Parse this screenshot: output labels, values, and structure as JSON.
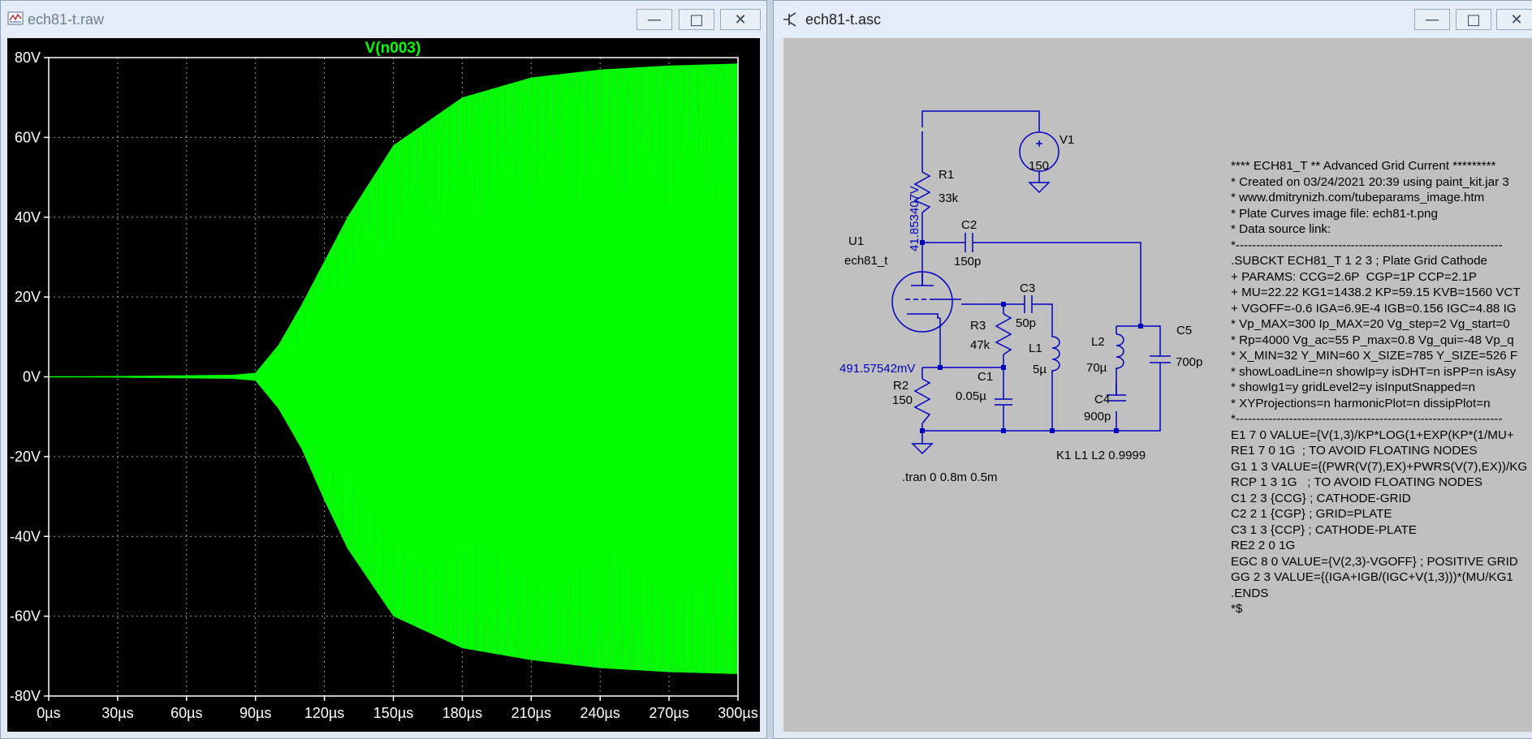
{
  "waveform_window": {
    "title": "ech81-t.raw",
    "trace_label": "V(n003)",
    "trace_color": "#00ff00",
    "y_ticks": [
      "80V",
      "60V",
      "40V",
      "20V",
      "0V",
      "-20V",
      "-40V",
      "-60V",
      "-80V"
    ],
    "x_ticks": [
      "0µs",
      "30µs",
      "60µs",
      "90µs",
      "120µs",
      "150µs",
      "180µs",
      "210µs",
      "240µs",
      "270µs",
      "300µs"
    ],
    "buttons": {
      "minimize": "—",
      "restore": "□",
      "close": "✕"
    }
  },
  "chart_data": {
    "type": "area",
    "title": "V(n003)",
    "xlabel": "",
    "ylabel": "",
    "x_unit": "µs",
    "y_unit": "V",
    "xlim": [
      0,
      300
    ],
    "ylim": [
      -80,
      80
    ],
    "grid": true,
    "series": [
      {
        "name": "V(n003)",
        "envelope_x": [
          0,
          80,
          90,
          100,
          110,
          120,
          130,
          150,
          180,
          210,
          240,
          270,
          300
        ],
        "envelope_upper": [
          0,
          0.5,
          1,
          8,
          18,
          29,
          40,
          58,
          70,
          75,
          77,
          78,
          78.5
        ],
        "envelope_lower": [
          0,
          -0.5,
          -1,
          -8,
          -18,
          -31,
          -43,
          -60,
          -68,
          -71,
          -73,
          -74,
          -74.5
        ]
      }
    ]
  },
  "schematic_window": {
    "title": "ech81-t.asc",
    "components": {
      "V1": {
        "name": "V1",
        "value": "150"
      },
      "R1": {
        "name": "R1",
        "value": "33k"
      },
      "C2": {
        "name": "C2",
        "value": "150p"
      },
      "U1": {
        "name": "U1",
        "model": "ech81_t"
      },
      "C3": {
        "name": "C3",
        "value": "50p"
      },
      "R3": {
        "name": "R3",
        "value": "47k"
      },
      "L1": {
        "name": "L1",
        "value": "5µ"
      },
      "L2": {
        "name": "L2",
        "value": "70µ"
      },
      "C5": {
        "name": "C5",
        "value": "700p"
      },
      "C1": {
        "name": "C1",
        "value": "0.05µ"
      },
      "R2": {
        "name": "R2",
        "value": "150"
      },
      "C4": {
        "name": "C4",
        "value": "900p"
      }
    },
    "node_voltages": {
      "plate": "41.853407V",
      "cathode": "491.57542mV"
    },
    "directives": {
      "coupling": "K1 L1 L2 0.9999",
      "tran": ".tran 0 0.8m 0.5m"
    },
    "netlist_lines": [
      "**** ECH81_T ** Advanced Grid Current *********",
      "* Created on 03/24/2021 20:39 using paint_kit.jar 3",
      "* www.dmitrynizh.com/tubeparams_image.htm",
      "* Plate Curves image file: ech81-t.png",
      "* Data source link:",
      "*-----------------------------------------------------------------",
      ".SUBCKT ECH81_T 1 2 3 ; Plate Grid Cathode",
      "+ PARAMS: CCG=2.6P  CGP=1P CCP=2.1P",
      "+ MU=22.22 KG1=1438.2 KP=59.15 KVB=1560 VCT",
      "+ VGOFF=-0.6 IGA=6.9E-4 IGB=0.156 IGC=4.88 IG",
      "* Vp_MAX=300 Ip_MAX=20 Vg_step=2 Vg_start=0",
      "* Rp=4000 Vg_ac=55 P_max=0.8 Vg_qui=-48 Vp_q",
      "* X_MIN=32 Y_MIN=60 X_SIZE=785 Y_SIZE=526 F",
      "* showLoadLine=n showIp=y isDHT=n isPP=n isAsy",
      "* showIg1=y gridLevel2=y isInputSnapped=n",
      "* XYProjections=n harmonicPlot=n dissipPlot=n",
      "*-----------------------------------------------------------------",
      "E1 7 0 VALUE={V(1,3)/KP*LOG(1+EXP(KP*(1/MU+",
      "RE1 7 0 1G  ; TO AVOID FLOATING NODES",
      "G1 1 3 VALUE={(PWR(V(7),EX)+PWRS(V(7),EX))/KG",
      "RCP 1 3 1G   ; TO AVOID FLOATING NODES",
      "C1 2 3 {CCG} ; CATHODE-GRID",
      "C2 2 1 {CGP} ; GRID=PLATE",
      "C3 1 3 {CCP} ; CATHODE-PLATE",
      "RE2 2 0 1G",
      "EGC 8 0 VALUE={V(2,3)-VGOFF} ; POSITIVE GRID",
      "GG 2 3 VALUE={(IGA+IGB/(IGC+V(1,3)))*(MU/KG1",
      ".ENDS",
      "*$"
    ],
    "buttons": {
      "minimize": "—",
      "restore": "□",
      "close": "✕"
    }
  }
}
